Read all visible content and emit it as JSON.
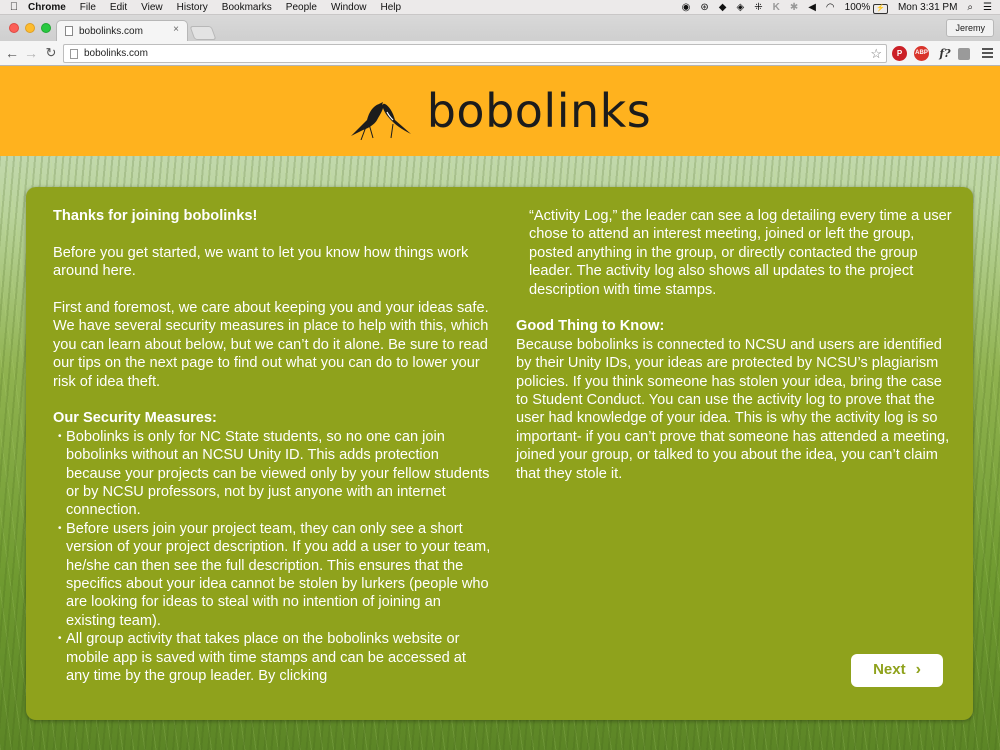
{
  "menubar": {
    "apple_icon": "apple-icon",
    "app_name": "Chrome",
    "items": [
      "File",
      "Edit",
      "View",
      "History",
      "Bookmarks",
      "People",
      "Window",
      "Help"
    ],
    "battery": "100%",
    "battery_badge": "⚡",
    "clock": "Mon 3:31 PM"
  },
  "browser": {
    "tab_title": "bobolinks.com",
    "profile_name": "Jeremy",
    "url": "bobolinks.com",
    "extensions": [
      "pinterest-icon",
      "adblock-icon",
      "font-inspector-icon",
      "extension-icon"
    ]
  },
  "site": {
    "logo_text": "bobolinks",
    "colors": {
      "header": "#ffb21e",
      "card": "#8fa21c",
      "button_text": "#8fa21c"
    }
  },
  "content": {
    "welcome_heading": "Thanks for joining bobolinks!",
    "intro": "Before you get started, we want to let you know how things work around here.",
    "safety": "First and foremost, we care about keeping you and your ideas safe. We have several security measures in place to help with this, which you can learn about below, but we can’t do it alone. Be sure to read our tips on the next page to find out what you can do to lower your risk of idea theft.",
    "security_heading": "Our Security Measures:",
    "bullets": [
      "Bobolinks is only for NC State students, so no one can join bobolinks without an NCSU Unity ID. This adds protection because your projects can be viewed only by your fellow students or by NCSU professors, not by just anyone with an internet connection.",
      "Before users join your project team, they can only see a short version of your project description. If you add a user to your team, he/she can then see the full description. This ensures that the specifics about your idea cannot be stolen by lurkers (people who are looking for ideas to steal with no intention of joining an existing team).",
      "All group activity that takes place on the bobolinks website or mobile app is saved with time stamps and can be accessed at any time by the group leader. By clicking"
    ],
    "bullet_continuation": "“Activity Log,” the leader can see a log detailing every time a user chose to attend an interest meeting, joined or left the group, posted anything in the group, or directly contacted the group leader. The activity log also shows all updates to the project description with time stamps.",
    "good_heading": "Good Thing to Know:",
    "good_text": "Because bobolinks is connected to NCSU and users are identified by their Unity IDs, your ideas are protected by NCSU’s plagiarism policies. If you think someone has stolen your idea, bring the case to Student Conduct. You can use the activity log to prove that the user had knowledge of your idea. This is why the activity log is so important- if you can’t prove that someone has attended a meeting, joined your group, or talked to you about the idea, you can’t claim that they stole it.",
    "next_label": "Next"
  }
}
